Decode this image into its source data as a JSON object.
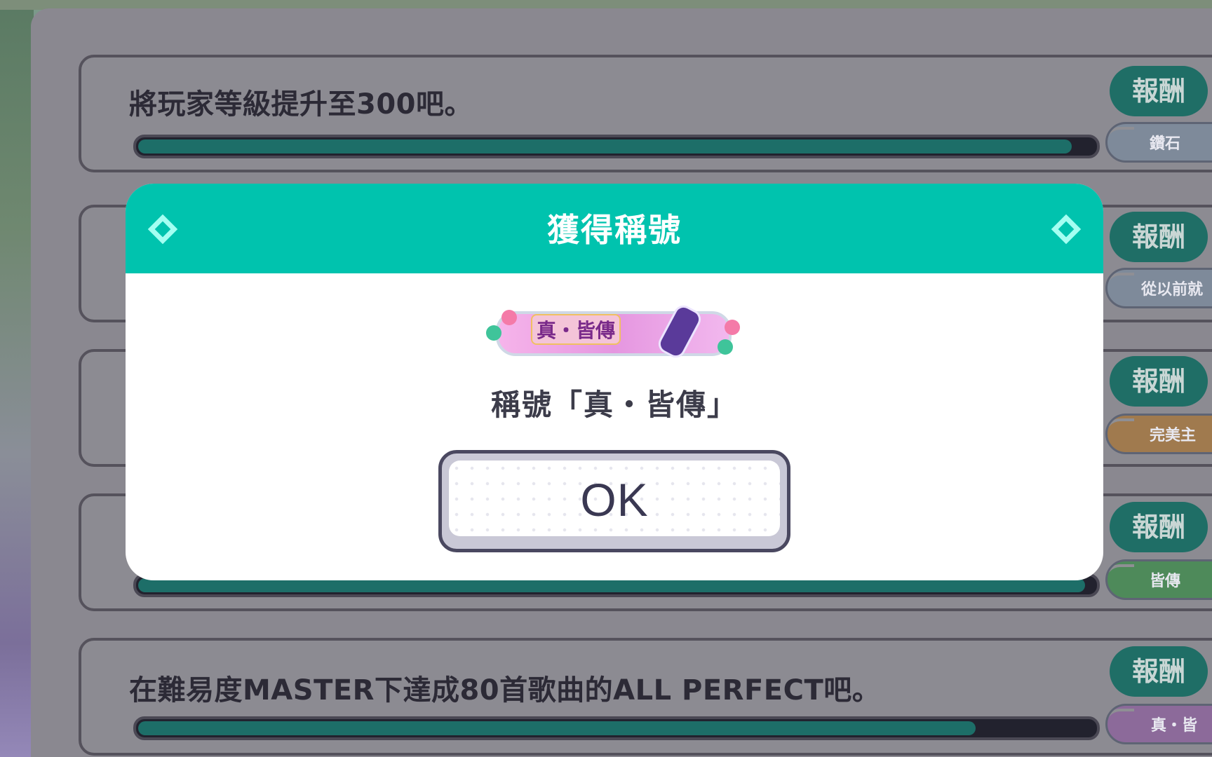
{
  "missions": [
    {
      "text": "將玩家等級提升至300吧。",
      "progress": 0.976,
      "reward_label": "報酬",
      "reward_item": "鑽石"
    },
    {
      "text": "",
      "progress": null,
      "reward_label": "報酬",
      "reward_item": "從以前就"
    },
    {
      "text": "",
      "progress": null,
      "reward_label": "報酬",
      "reward_item": "完美主"
    },
    {
      "text": "",
      "progress": 0.99,
      "reward_label": "報酬",
      "reward_item": "皆傳"
    },
    {
      "text": "在難易度MASTER下達成80首歌曲的ALL PERFECT吧。",
      "progress": 0.876,
      "reward_label": "報酬",
      "reward_item": "真・皆"
    }
  ],
  "dialog": {
    "title": "獲得稱號",
    "badge_text": "真・皆傳",
    "message": "稱號「真・皆傳」",
    "ok_label": "OK"
  },
  "colors": {
    "header_teal": "#00c3ae",
    "reward_green": "#1f6e66",
    "progress_fill": "#1d6e68",
    "overlay_panel": "#8a8890"
  }
}
